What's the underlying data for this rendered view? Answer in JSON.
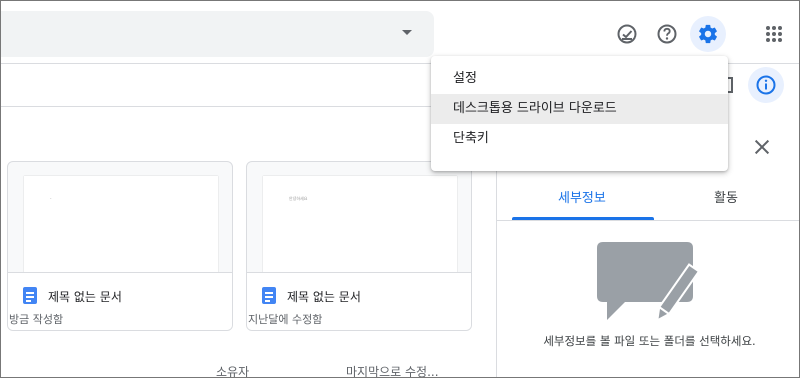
{
  "icons": {
    "search_options": "caret-down-icon",
    "ready_offline": "check-circle-icon",
    "help": "help-icon",
    "settings": "gear-icon",
    "apps": "apps-grid-icon",
    "view_toggle": "view-toggle-icon",
    "info": "info-icon",
    "close": "close-icon"
  },
  "colors": {
    "accent": "#1a73e8",
    "doc_icon": "#4285f4",
    "selected_bg": "#e8f0fe",
    "menu_hover": "#ececec"
  },
  "settings_menu": {
    "items": [
      {
        "label": "설정"
      },
      {
        "label": "데스크톱용 드라이브 다운로드",
        "hovered": true
      },
      {
        "label": "단축키"
      }
    ]
  },
  "files": [
    {
      "title": "제목 없는 문서",
      "subtitle": "방금 작성함",
      "thumb_text": "-"
    },
    {
      "title": "제목 없는 문서",
      "subtitle": "지난달에 수정함",
      "thumb_text": "안녕하세요"
    }
  ],
  "columns": {
    "owner": "소유자",
    "modified": "마지막으로 수정..."
  },
  "details_panel": {
    "tabs": [
      "세부정보",
      "활동"
    ],
    "active_tab": "세부정보",
    "empty_message": "세부정보를 볼 파일 또는 폴더를 선택하세요."
  }
}
